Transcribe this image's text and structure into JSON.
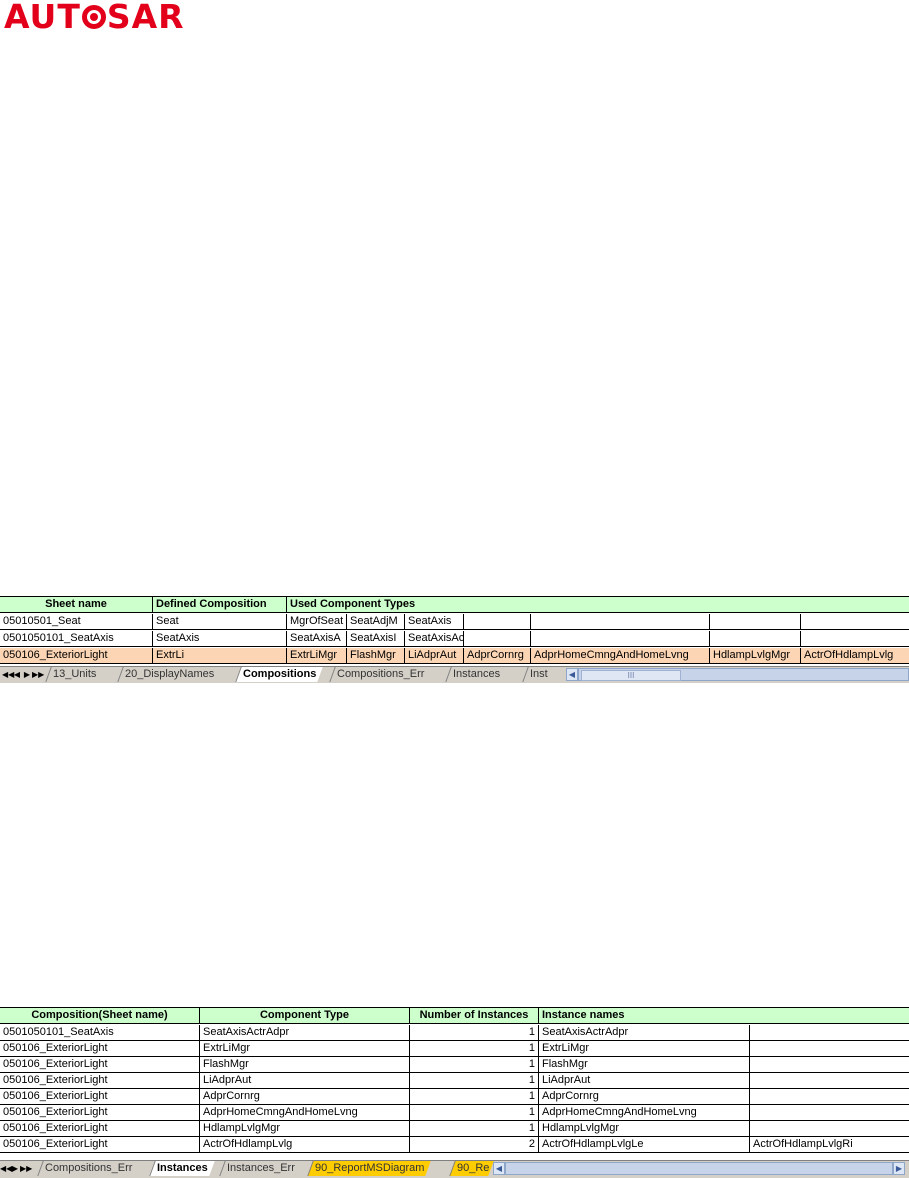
{
  "logo": {
    "text_before": "AUT",
    "text_after": "SAR",
    "brand_color": "#e2001a"
  },
  "sheet1": {
    "headers": [
      "Sheet name",
      "Defined Composition",
      "Used Component Types"
    ],
    "rows": [
      [
        "05010501_Seat",
        "Seat",
        "MgrOfSeat",
        "SeatAdjM",
        "SeatAxis",
        "",
        "",
        "",
        ""
      ],
      [
        "0501050101_SeatAxis",
        "SeatAxis",
        "SeatAxisA",
        "SeatAxisI",
        "SeatAxisActrAdpr",
        "",
        "",
        "",
        ""
      ],
      [
        "050106_ExteriorLight",
        "ExtrLi",
        "ExtrLiMgr",
        "FlashMgr",
        "LiAdprAut",
        "AdprCornrg",
        "AdprHomeCmngAndHomeLvng",
        "HdlampLvlgMgr",
        "ActrOfHdlampLvlg"
      ]
    ],
    "tabs": [
      "13_Units",
      "20_DisplayNames",
      "Compositions",
      "Compositions_Err",
      "Instances",
      "Inst"
    ],
    "active_tab": "Compositions",
    "highlight_color": "#fcd5b4",
    "header_color": "#ccffcc"
  },
  "sheet2": {
    "headers": [
      "Composition(Sheet name)",
      "Component Type",
      "Number of Instances",
      "Instance names"
    ],
    "rows": [
      [
        "0501050101_SeatAxis",
        "SeatAxisActrAdpr",
        "1",
        "SeatAxisActrAdpr",
        ""
      ],
      [
        "050106_ExteriorLight",
        "ExtrLiMgr",
        "1",
        "ExtrLiMgr",
        ""
      ],
      [
        "050106_ExteriorLight",
        "FlashMgr",
        "1",
        "FlashMgr",
        ""
      ],
      [
        "050106_ExteriorLight",
        "LiAdprAut",
        "1",
        "LiAdprAut",
        ""
      ],
      [
        "050106_ExteriorLight",
        "AdprCornrg",
        "1",
        "AdprCornrg",
        ""
      ],
      [
        "050106_ExteriorLight",
        "AdprHomeCmngAndHomeLvng",
        "1",
        "AdprHomeCmngAndHomeLvng",
        ""
      ],
      [
        "050106_ExteriorLight",
        "HdlampLvlgMgr",
        "1",
        "HdlampLvlgMgr",
        ""
      ],
      [
        "050106_ExteriorLight",
        "ActrOfHdlampLvlg",
        "2",
        "ActrOfHdlampLvlgLe",
        "ActrOfHdlampLvlgRi"
      ]
    ],
    "tabs": [
      "Compositions_Err",
      "Instances",
      "Instances_Err",
      "90_ReportMSDiagram",
      "90_Re"
    ],
    "active_tab": "Instances",
    "yellow_tabs": [
      "90_ReportMSDiagram",
      "90_Re"
    ]
  }
}
